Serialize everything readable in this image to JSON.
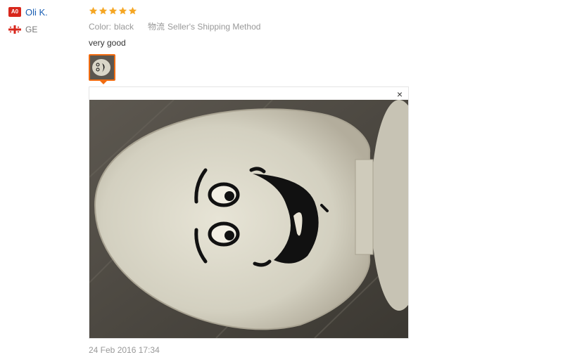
{
  "reviewer": {
    "avatar_initials": "A0",
    "name": "Oli K.",
    "country": "GE",
    "flag_icon": "georgia-flag-icon"
  },
  "rating": {
    "stars": 5,
    "max": 5,
    "color": "#f5a623"
  },
  "attributes": {
    "color_label": "Color:",
    "color_value": "black",
    "shipping_label": "物流",
    "shipping_value": "Seller's Shipping Method"
  },
  "review": {
    "text": "very good"
  },
  "photo_viewer": {
    "close_label": "×"
  },
  "timestamp": "24 Feb 2016 17:34",
  "colors": {
    "accent": "#f06b10",
    "link": "#1a5fb4",
    "badge": "#d8271c"
  }
}
